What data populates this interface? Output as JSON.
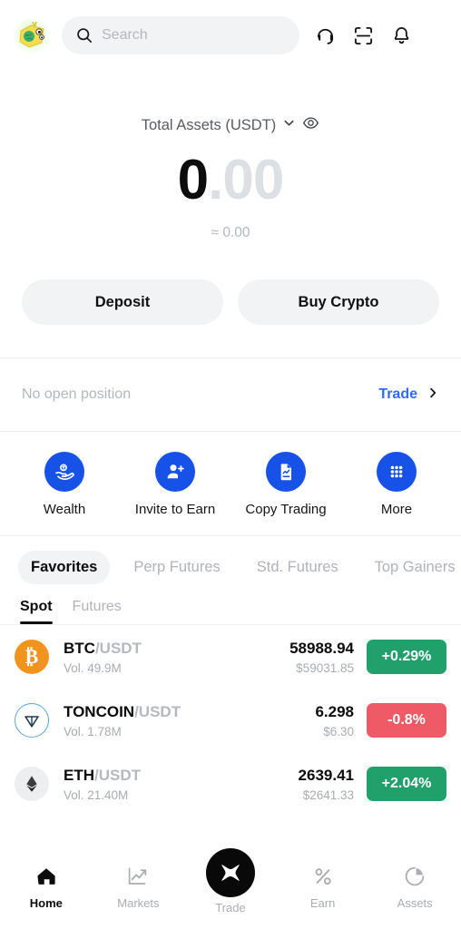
{
  "colors": {
    "brand_blue": "#1652e8",
    "link_blue": "#2f6bff",
    "up_green": "#22a06b",
    "down_red": "#ee5a66",
    "surface_gray": "#f2f3f5",
    "btc_orange": "#f0941d"
  },
  "header": {
    "logo_name": "app-logo",
    "search": {
      "placeholder": "Search",
      "value": ""
    },
    "actions": [
      {
        "name": "support-headset-icon",
        "label": "Support"
      },
      {
        "name": "scan-qr-icon",
        "label": "Scan"
      },
      {
        "name": "notification-bell-icon",
        "label": "Notifications"
      }
    ]
  },
  "balance": {
    "label": "Total Assets (USDT)",
    "amount_int": "0",
    "amount_dec": ".00",
    "approx": "≈ 0.00"
  },
  "actions": {
    "deposit_label": "Deposit",
    "buy_crypto_label": "Buy Crypto"
  },
  "position": {
    "empty_text": "No open position",
    "trade_label": "Trade"
  },
  "quick_actions": [
    {
      "label": "Wealth",
      "icon": "hand-coin-icon"
    },
    {
      "label": "Invite to Earn",
      "icon": "person-add-icon"
    },
    {
      "label": "Copy Trading",
      "icon": "document-chart-icon"
    },
    {
      "label": "More",
      "icon": "grid-dots-icon"
    }
  ],
  "market_tabs": [
    {
      "label": "Favorites",
      "active": true
    },
    {
      "label": "Perp Futures",
      "active": false
    },
    {
      "label": "Std. Futures",
      "active": false
    },
    {
      "label": "Top Gainers",
      "active": false
    }
  ],
  "sub_tabs": [
    {
      "label": "Spot",
      "active": true
    },
    {
      "label": "Futures",
      "active": false
    }
  ],
  "coins": [
    {
      "base": "BTC",
      "quote": "/USDT",
      "volume": "Vol. 49.9M",
      "price": "58988.94",
      "price_usd": "$59031.85",
      "change": "+0.29%",
      "direction": "up",
      "icon": "bitcoin-icon"
    },
    {
      "base": "TONCOIN",
      "quote": "/USDT",
      "volume": "Vol. 1.78M",
      "price": "6.298",
      "price_usd": "$6.30",
      "change": "-0.8%",
      "direction": "down",
      "icon": "toncoin-icon"
    },
    {
      "base": "ETH",
      "quote": "/USDT",
      "volume": "Vol. 21.40M",
      "price": "2639.41",
      "price_usd": "$2641.33",
      "change": "+2.04%",
      "direction": "up",
      "icon": "ethereum-icon"
    }
  ],
  "bottom_nav": [
    {
      "label": "Home",
      "icon": "home-icon",
      "active": true
    },
    {
      "label": "Markets",
      "icon": "chart-trend-icon",
      "active": false
    },
    {
      "label": "Trade",
      "icon": "bingx-logo-icon",
      "active": false
    },
    {
      "label": "Earn",
      "icon": "percent-icon",
      "active": false
    },
    {
      "label": "Assets",
      "icon": "pie-chart-icon",
      "active": false
    }
  ]
}
